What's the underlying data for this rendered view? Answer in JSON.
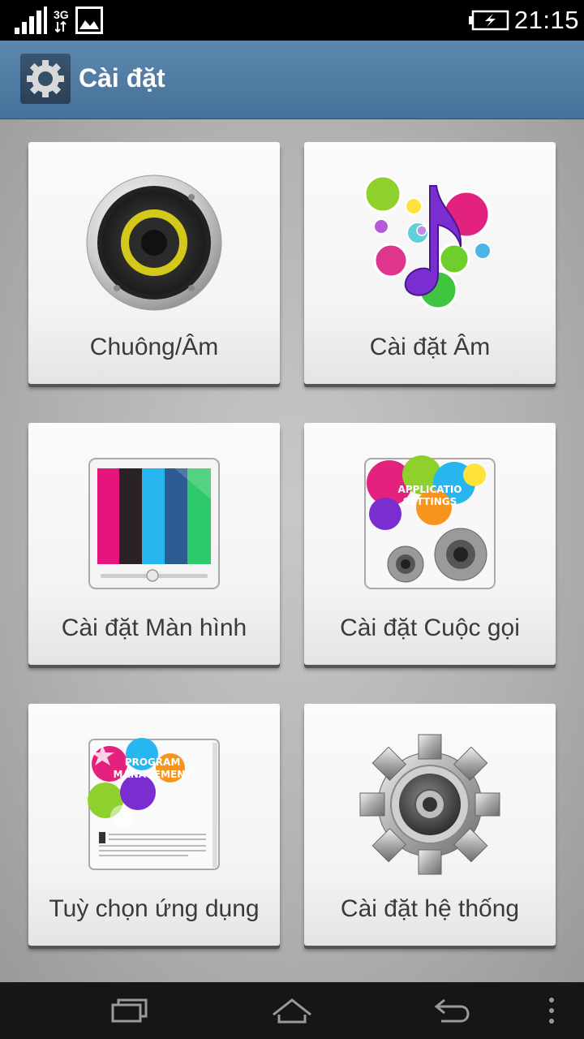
{
  "status_bar": {
    "network_type": "3G",
    "time": "21:15",
    "icons": [
      "signal-icon",
      "data-activity-icon",
      "gallery-notification-icon",
      "battery-charging-icon"
    ]
  },
  "action_bar": {
    "title": "Cài đặt",
    "icon": "gear-icon",
    "color": "#4f7aa2"
  },
  "tiles": [
    {
      "label": "Chuông/Âm",
      "icon": "speaker-icon"
    },
    {
      "label": "Cài đặt Âm",
      "icon": "music-note-icon"
    },
    {
      "label": "Cài đặt Màn hình",
      "icon": "display-icon"
    },
    {
      "label": "Cài đặt Cuộc gọi",
      "icon": "application-settings-icon",
      "art_text": [
        "APPLICATIO",
        "SETTINGS"
      ]
    },
    {
      "label": "Tuỳ chọn ứng dụng",
      "icon": "program-management-icon",
      "art_text": [
        "PROGRAM",
        "MANAGEMENT"
      ]
    },
    {
      "label": "Cài đặt hệ thống",
      "icon": "system-gear-icon"
    }
  ],
  "nav_bar": {
    "buttons": [
      "recent-apps-icon",
      "home-icon",
      "back-icon",
      "menu-icon"
    ]
  }
}
